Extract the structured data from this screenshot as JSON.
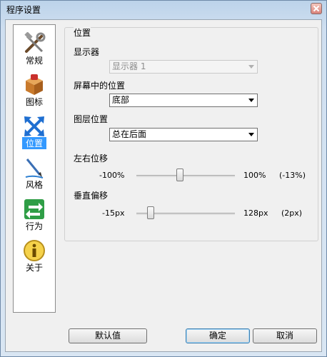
{
  "window": {
    "title": "程序设置"
  },
  "sidebar": {
    "items": [
      {
        "label": "常规",
        "icon": "tools-icon"
      },
      {
        "label": "图标",
        "icon": "package-icon"
      },
      {
        "label": "位置",
        "icon": "move-arrows-icon"
      },
      {
        "label": "风格",
        "icon": "pen-icon"
      },
      {
        "label": "行为",
        "icon": "arrows-exchange-icon"
      },
      {
        "label": "关于",
        "icon": "info-icon"
      }
    ],
    "selected_index": 2
  },
  "position_group": {
    "title": "位置",
    "display_label": "显示器",
    "display_value": "显示器 1",
    "screen_position_label": "屏幕中的位置",
    "screen_position_value": "底部",
    "layer_label": "图层位置",
    "layer_value": "总在后面",
    "horizontal": {
      "label": "左右位移",
      "min_label": "-100%",
      "max_label": "100%",
      "value_label": "(-13%)",
      "value": -13,
      "min": -100,
      "max": 100
    },
    "vertical": {
      "label": "垂直偏移",
      "min_label": "-15px",
      "max_label": "128px",
      "value_label": "(2px)",
      "value": 2,
      "min": -15,
      "max": 128
    }
  },
  "buttons": {
    "defaults": "默认值",
    "ok": "确定",
    "cancel": "取消"
  },
  "colors": {
    "selection": "#3399ff"
  }
}
